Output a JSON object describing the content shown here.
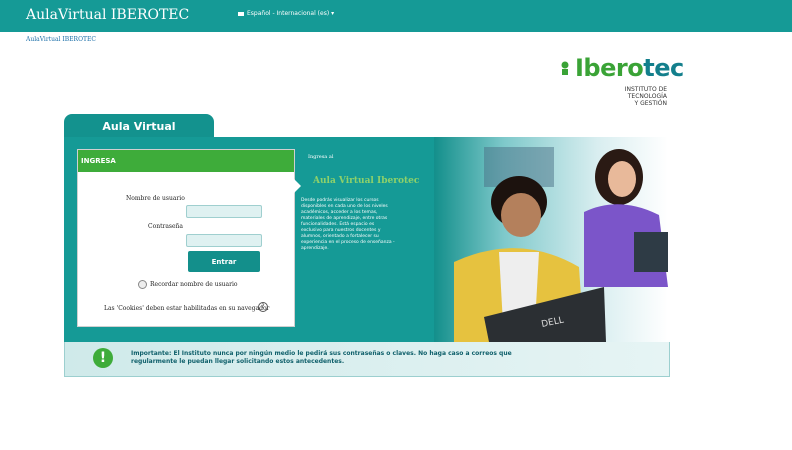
{
  "header": {
    "title": "AulaVirtual IBEROTEC",
    "language": "Español - Internacional (es) ▾"
  },
  "breadcrumb": "AulaVirtual IBEROTEC",
  "logo": {
    "brand_a": "Ibero",
    "brand_b": "tec",
    "sub1": "INSTITUTO DE",
    "sub2": "TECNOLOGÍA",
    "sub3": "Y GESTIÓN"
  },
  "tab": {
    "label": "Aula Virtual"
  },
  "login": {
    "header": "INGRESA",
    "username_label": "Nombre de usuario",
    "password_label": "Contraseña",
    "submit_label": "Entrar",
    "remember_label": "Recordar nombre de usuario",
    "cookies_label": "Las 'Cookies' deben estar habilitadas en su navegador"
  },
  "info": {
    "small": "Ingresa al",
    "title": "Aula Virtual Iberotec",
    "body": "Desde podrás visualizar los cursos disponibles en cada uno de los niveles académicos, acceder a los temas, materiales de aprendizaje, entre otras funcionalidades. Está espacio es exclusivo para nuestros docentes y alumnos, orientado a fortalecer su experiencia en el proceso de enseñanza - aprendizaje."
  },
  "notice": {
    "strong": "Importante:",
    "text": "El Instituto nunca por ningún medio le pedirá sus contraseñas o claves. No haga caso a correos que regularmente le puedan llegar solicitando estos antecedentes."
  },
  "colors": {
    "teal": "#159a96",
    "green": "#3eac3a"
  }
}
